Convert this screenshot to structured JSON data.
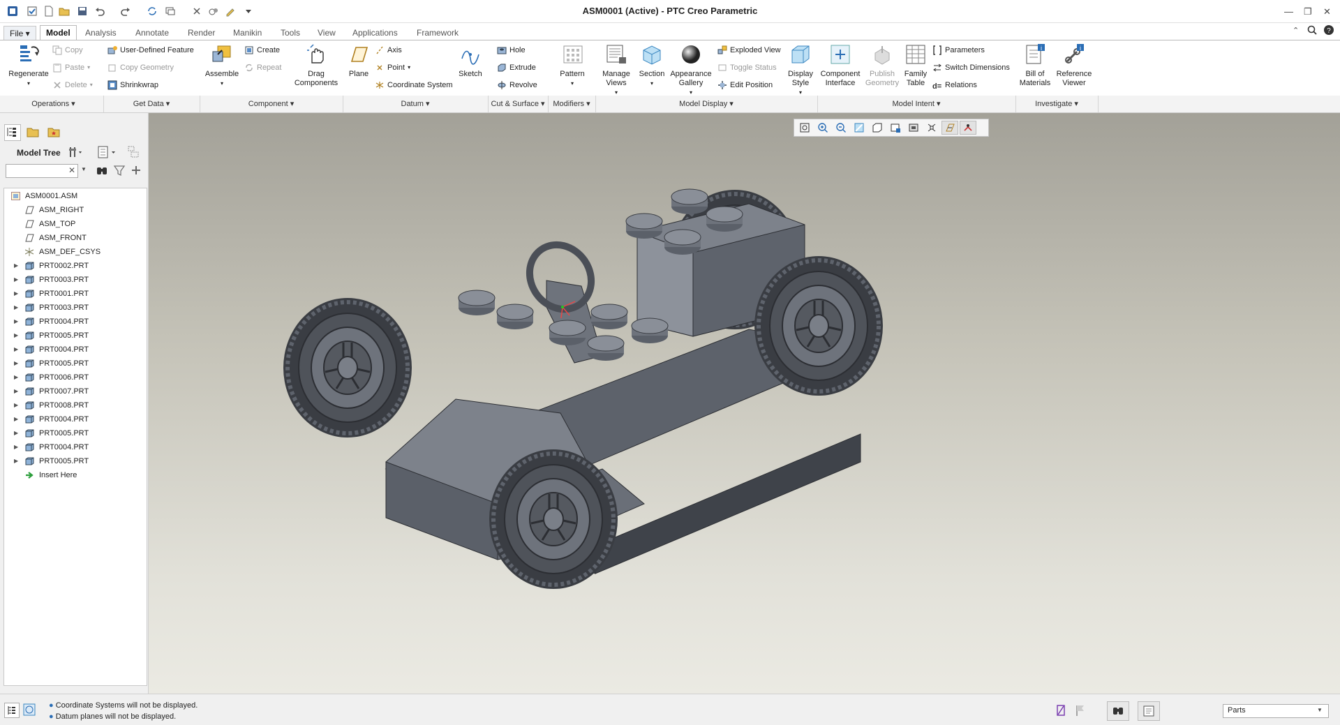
{
  "window": {
    "title": "ASM0001 (Active) - PTC Creo Parametric"
  },
  "tabs": [
    {
      "label": "File ▾"
    },
    {
      "label": "Model"
    },
    {
      "label": "Analysis"
    },
    {
      "label": "Annotate"
    },
    {
      "label": "Render"
    },
    {
      "label": "Manikin"
    },
    {
      "label": "Tools"
    },
    {
      "label": "View"
    },
    {
      "label": "Applications"
    },
    {
      "label": "Framework"
    }
  ],
  "ribbon": {
    "regenerate": "Regenerate",
    "copy": "Copy",
    "paste": "Paste",
    "delete": "Delete",
    "user_defined_feature": "User-Defined Feature",
    "copy_geometry": "Copy Geometry",
    "shrinkwrap": "Shrinkwrap",
    "assemble": "Assemble",
    "create": "Create",
    "repeat": "Repeat",
    "drag_components": "Drag Components",
    "plane": "Plane",
    "axis": "Axis",
    "point": "Point",
    "coordinate_system": "Coordinate System",
    "sketch": "Sketch",
    "hole": "Hole",
    "extrude": "Extrude",
    "revolve": "Revolve",
    "pattern": "Pattern",
    "manage_views": "Manage Views",
    "section": "Section",
    "appearance_gallery": "Appearance Gallery",
    "exploded_view": "Exploded View",
    "toggle_status": "Toggle Status",
    "edit_position": "Edit Position",
    "display_style": "Display Style",
    "component_interface": "Component Interface",
    "publish_geometry": "Publish Geometry",
    "family_table": "Family Table",
    "parameters": "Parameters",
    "switch_dimensions": "Switch Dimensions",
    "relations": "Relations",
    "bill_of_materials": "Bill of Materials",
    "reference_viewer": "Reference Viewer"
  },
  "groups": [
    {
      "label": "Operations ▾"
    },
    {
      "label": "Get Data ▾"
    },
    {
      "label": "Component ▾"
    },
    {
      "label": "Datum ▾"
    },
    {
      "label": "Cut & Surface ▾"
    },
    {
      "label": "Modifiers ▾"
    },
    {
      "label": "Model Display ▾"
    },
    {
      "label": "Model Intent ▾"
    },
    {
      "label": "Investigate ▾"
    }
  ],
  "model_tree": {
    "title": "Model Tree",
    "search_value": "",
    "items": [
      {
        "label": "ASM0001.ASM",
        "type": "asm"
      },
      {
        "label": "ASM_RIGHT",
        "type": "plane"
      },
      {
        "label": "ASM_TOP",
        "type": "plane"
      },
      {
        "label": "ASM_FRONT",
        "type": "plane"
      },
      {
        "label": "ASM_DEF_CSYS",
        "type": "csys"
      },
      {
        "label": "PRT0002.PRT",
        "type": "part"
      },
      {
        "label": "PRT0003.PRT",
        "type": "part"
      },
      {
        "label": "PRT0001.PRT",
        "type": "part"
      },
      {
        "label": "PRT0003.PRT",
        "type": "part"
      },
      {
        "label": "PRT0004.PRT",
        "type": "part"
      },
      {
        "label": "PRT0005.PRT",
        "type": "part"
      },
      {
        "label": "PRT0004.PRT",
        "type": "part"
      },
      {
        "label": "PRT0005.PRT",
        "type": "part"
      },
      {
        "label": "PRT0006.PRT",
        "type": "part"
      },
      {
        "label": "PRT0007.PRT",
        "type": "part"
      },
      {
        "label": "PRT0008.PRT",
        "type": "part"
      },
      {
        "label": "PRT0004.PRT",
        "type": "part"
      },
      {
        "label": "PRT0005.PRT",
        "type": "part"
      },
      {
        "label": "PRT0004.PRT",
        "type": "part"
      },
      {
        "label": "PRT0005.PRT",
        "type": "part"
      },
      {
        "label": "Insert Here",
        "type": "insert"
      }
    ]
  },
  "status": {
    "messages": [
      "Coordinate Systems will not be displayed.",
      "Datum planes will not be displayed."
    ],
    "filter_value": "Parts"
  },
  "colors": {
    "accent": "#2a6db5",
    "viewport_top": "#a3a198",
    "viewport_bottom": "#ebeae3",
    "model": "#6e737c"
  }
}
